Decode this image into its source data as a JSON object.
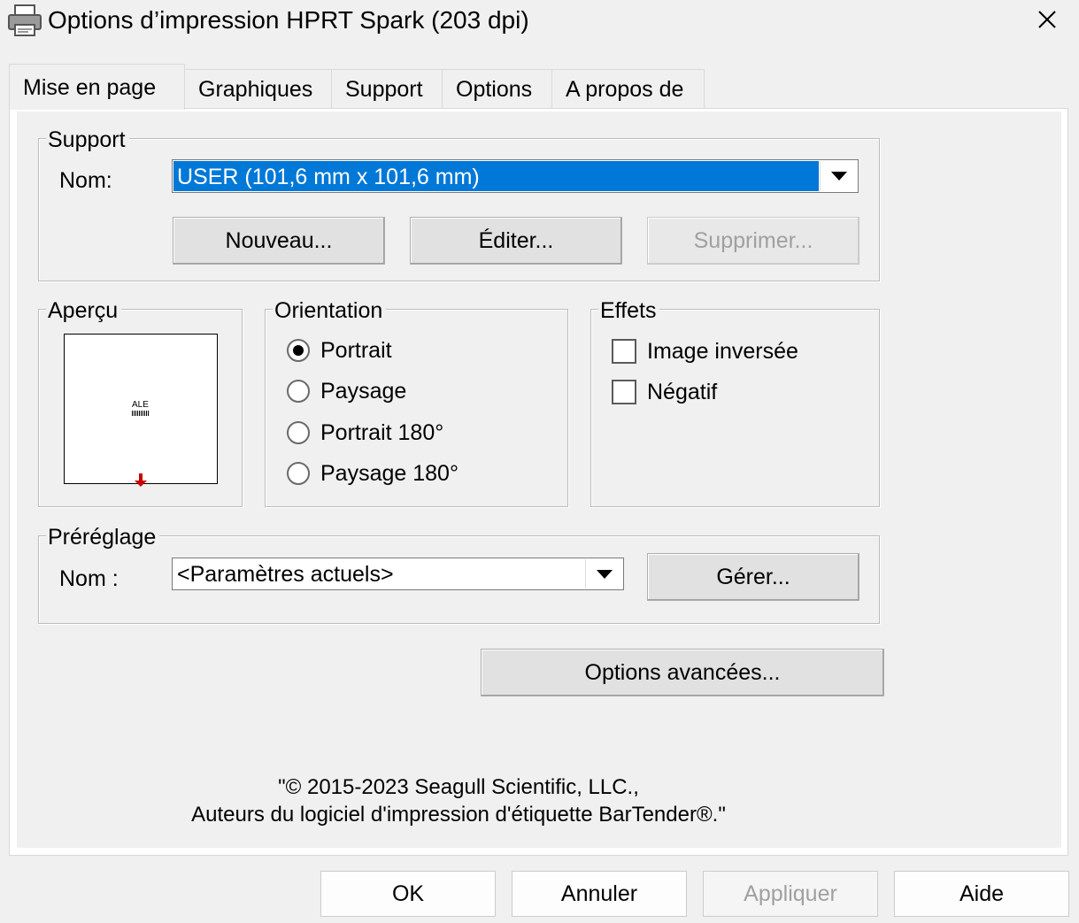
{
  "window": {
    "title": "Options d’impression HPRT Spark (203 dpi)",
    "icon": "printer-icon",
    "close_icon": "close-icon"
  },
  "tabs": [
    {
      "label": "Mise en page",
      "active": true
    },
    {
      "label": "Graphiques",
      "active": false
    },
    {
      "label": "Support",
      "active": false
    },
    {
      "label": "Options",
      "active": false
    },
    {
      "label": "A propos de",
      "active": false
    }
  ],
  "support": {
    "group_label": "Support",
    "name_label": "Nom:",
    "selected": "USER (101,6 mm x 101,6 mm)",
    "new_button": "Nouveau...",
    "edit_button": "Éditer...",
    "delete_button": "Supprimer..."
  },
  "preview": {
    "group_label": "Aperçu",
    "label_text": "ALE"
  },
  "orientation": {
    "group_label": "Orientation",
    "options": [
      {
        "label": "Portrait",
        "checked": true
      },
      {
        "label": "Paysage",
        "checked": false
      },
      {
        "label": "Portrait 180°",
        "checked": false
      },
      {
        "label": "Paysage 180°",
        "checked": false
      }
    ]
  },
  "effects": {
    "group_label": "Effets",
    "options": [
      {
        "label": "Image inversée",
        "checked": false
      },
      {
        "label": "Négatif",
        "checked": false
      }
    ]
  },
  "preset": {
    "group_label": "Préréglage",
    "name_label": "Nom :",
    "selected": "<Paramètres actuels>",
    "manage_button": "Gérer..."
  },
  "advanced_button": "Options avancées...",
  "copyright": {
    "line1": "\"© 2015-2023 Seagull Scientific, LLC.,",
    "line2": "Auteurs du logiciel d'impression d'étiquette BarTender®.\""
  },
  "footer": {
    "ok": "OK",
    "cancel": "Annuler",
    "apply": "Appliquer",
    "help": "Aide"
  },
  "colors": {
    "selection": "#0078d7",
    "preview_arrow": "#cc0000"
  }
}
